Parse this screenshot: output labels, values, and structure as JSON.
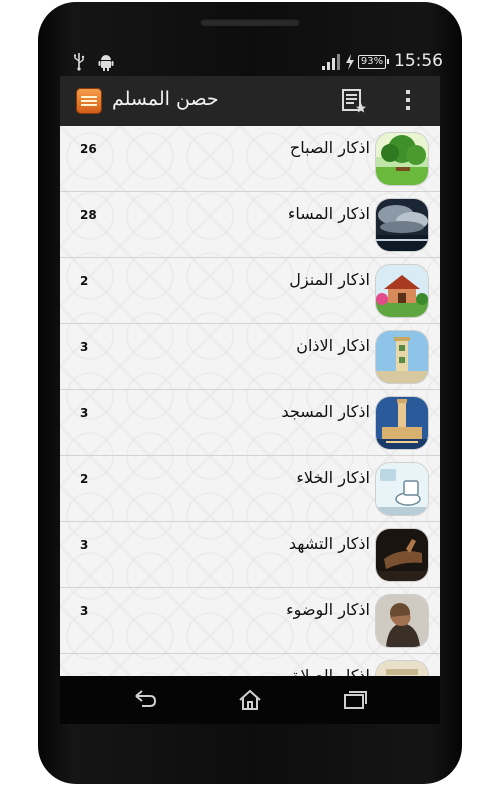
{
  "status_bar": {
    "time": "15:56",
    "battery": "93%"
  },
  "action_bar": {
    "title": "حصن المسلم"
  },
  "items": [
    {
      "title": "اذكار الصباح",
      "count": "26",
      "thumb": "morning-park-image"
    },
    {
      "title": "اذكار المساء",
      "count": "28",
      "thumb": "evening-clouds-image"
    },
    {
      "title": "اذكار المنزل",
      "count": "2",
      "thumb": "house-image"
    },
    {
      "title": "اذكار الاذان",
      "count": "3",
      "thumb": "minaret-image"
    },
    {
      "title": "اذكار المسجد",
      "count": "3",
      "thumb": "mosque-image"
    },
    {
      "title": "اذكار الخلاء",
      "count": "2",
      "thumb": "bathroom-image"
    },
    {
      "title": "اذكار التشهد",
      "count": "3",
      "thumb": "prayer-hand-image"
    },
    {
      "title": "اذكار الوضوء",
      "count": "3",
      "thumb": "ablution-image"
    },
    {
      "title": "اذكار الصلاة",
      "count": "",
      "thumb": "prayer-image"
    }
  ]
}
